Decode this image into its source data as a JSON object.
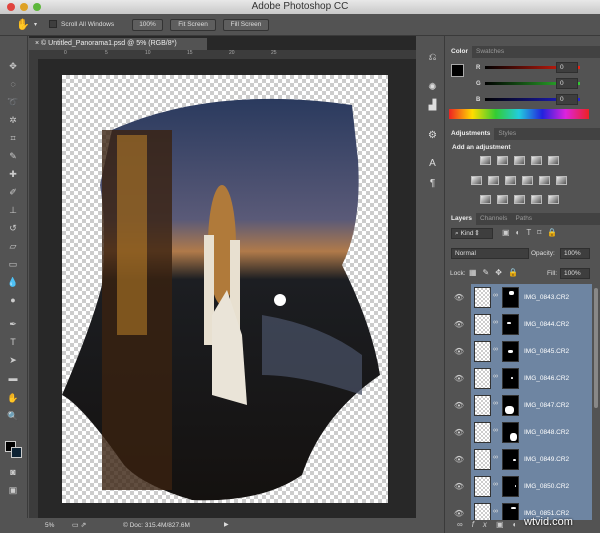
{
  "app": {
    "title": "Adobe Photoshop CC"
  },
  "options": {
    "scroll_all": "Scroll All Windows",
    "btn_100": "100%",
    "btn_fit": "Fit Screen",
    "btn_fill": "Fill Screen"
  },
  "document": {
    "tab": "© Untitled_Panorama1.psd @ 5% (RGB/8*)",
    "ruler": [
      "0",
      "5",
      "10",
      "15",
      "20",
      "25"
    ],
    "zoom": "5%",
    "doc_info": "© Doc: 315.4M/827.6M"
  },
  "color_panel": {
    "tabs": [
      "Color",
      "Swatches"
    ],
    "r_label": "R",
    "g_label": "G",
    "b_label": "B",
    "r": "0",
    "g": "0",
    "b": "0"
  },
  "adjustments_panel": {
    "tabs": [
      "Adjustments",
      "Styles"
    ],
    "heading": "Add an adjustment"
  },
  "layers_panel": {
    "tabs": [
      "Layers",
      "Channels",
      "Paths"
    ],
    "filter": "Kind",
    "blend": "Normal",
    "opacity_label": "Opacity:",
    "opacity": "100%",
    "lock_label": "Lock:",
    "fill_label": "Fill:",
    "fill": "100%",
    "layers": [
      {
        "name": "IMG_0843.CR2"
      },
      {
        "name": "IMG_0844.CR2"
      },
      {
        "name": "IMG_0845.CR2"
      },
      {
        "name": "IMG_0846.CR2"
      },
      {
        "name": "IMG_0847.CR2"
      },
      {
        "name": "IMG_0848.CR2"
      },
      {
        "name": "IMG_0849.CR2"
      },
      {
        "name": "IMG_0850.CR2"
      },
      {
        "name": "IMG_0851.CR2"
      }
    ]
  },
  "watermark": "wtvid.com"
}
